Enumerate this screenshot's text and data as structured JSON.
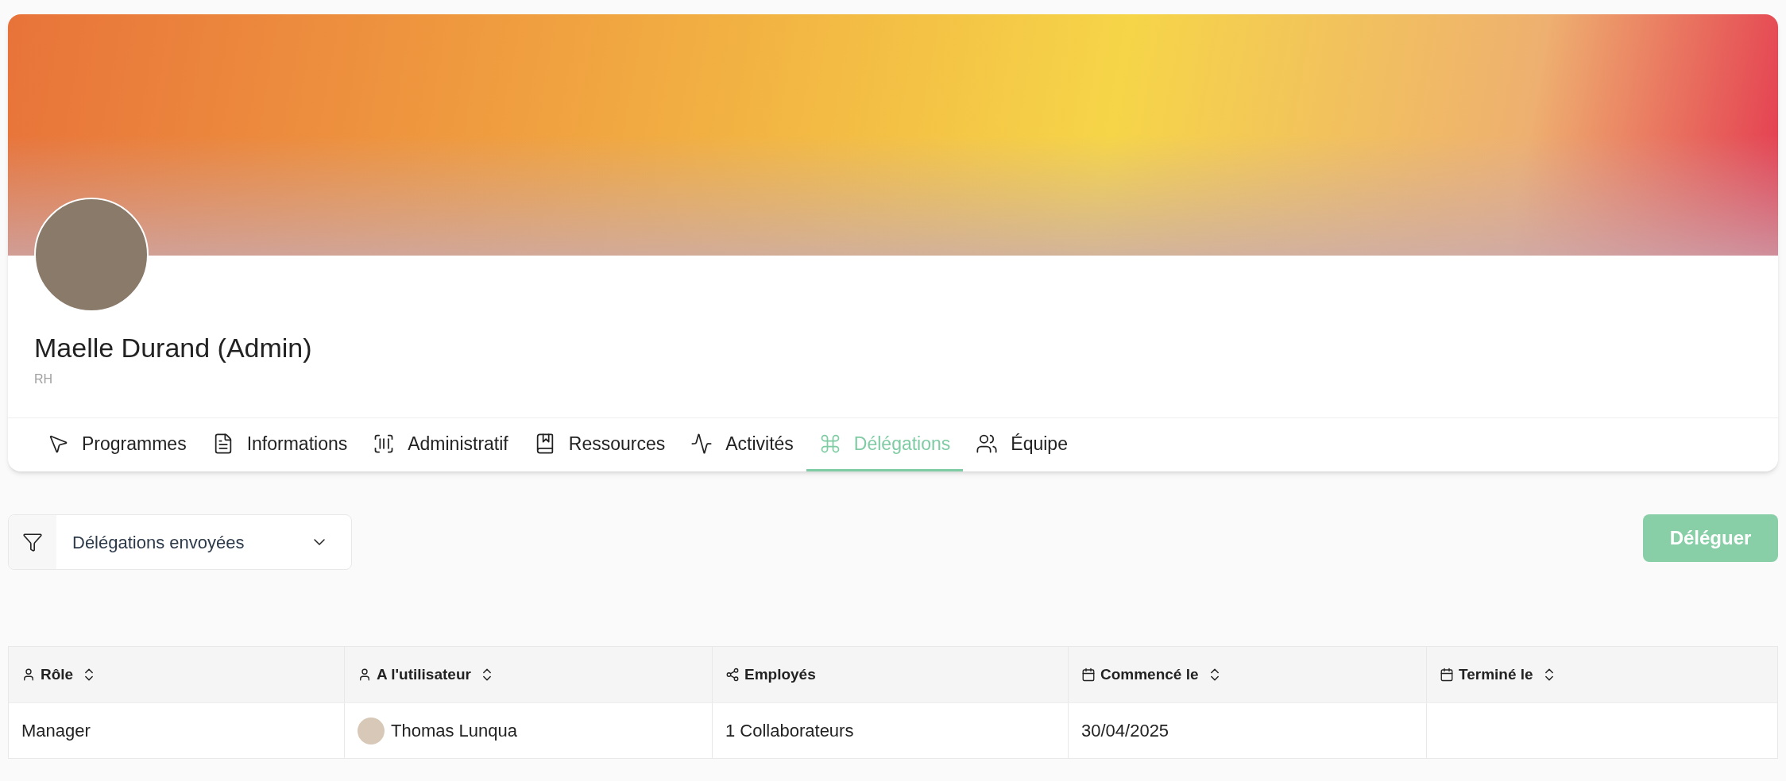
{
  "profile": {
    "name": "Maelle Durand (Admin)",
    "department": "RH"
  },
  "tabs": [
    {
      "label": "Programmes",
      "selected": false
    },
    {
      "label": "Informations",
      "selected": false
    },
    {
      "label": "Administratif",
      "selected": false
    },
    {
      "label": "Ressources",
      "selected": false
    },
    {
      "label": "Activités",
      "selected": false
    },
    {
      "label": "Délégations",
      "selected": true
    },
    {
      "label": "Équipe",
      "selected": false
    }
  ],
  "filter": {
    "value": "Délégations envoyées"
  },
  "delegate_button": {
    "label": "Déléguer",
    "disabled": true
  },
  "table": {
    "columns": [
      {
        "label": "Rôle",
        "sortable": true
      },
      {
        "label": "A l'utilisateur",
        "sortable": true
      },
      {
        "label": "Employés",
        "sortable": false
      },
      {
        "label": "Commencé le",
        "sortable": true
      },
      {
        "label": "Terminé le",
        "sortable": true
      }
    ],
    "rows": [
      {
        "role": "Manager",
        "user": "Thomas Lunqua",
        "employees": "1 Collaborateurs",
        "started": "30/04/2025",
        "ended": ""
      }
    ]
  }
}
